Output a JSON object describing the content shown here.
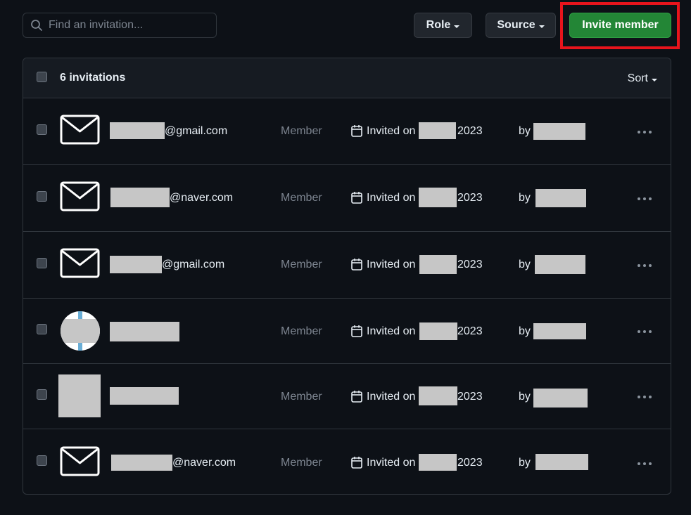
{
  "search": {
    "placeholder": "Find an invitation..."
  },
  "filters": {
    "role_label": "Role",
    "source_label": "Source"
  },
  "invite_button_label": "Invite member",
  "list": {
    "count_label": "6 invitations",
    "sort_label": "Sort"
  },
  "rows": [
    {
      "avatar": "mail-icon",
      "email_suffix": "@gmail.com",
      "role": "Member",
      "invited_label": "Invited on",
      "year": "2023",
      "by_label": "by"
    },
    {
      "avatar": "mail-icon",
      "email_suffix": "@naver.com",
      "role": "Member",
      "invited_label": "Invited on",
      "year": "2023",
      "by_label": "by"
    },
    {
      "avatar": "mail-icon",
      "email_suffix": "@gmail.com",
      "role": "Member",
      "invited_label": "Invited on",
      "year": "2023",
      "by_label": "by"
    },
    {
      "avatar": "user-avatar",
      "email_suffix": "",
      "role": "Member",
      "invited_label": "Invited on",
      "year": "2023",
      "by_label": "by"
    },
    {
      "avatar": "user-avatar",
      "email_suffix": "",
      "role": "Member",
      "invited_label": "Invited on",
      "year": "2023",
      "by_label": "by"
    },
    {
      "avatar": "mail-icon",
      "email_suffix": "@naver.com",
      "role": "Member",
      "invited_label": "Invited on",
      "year": "2023",
      "by_label": "by"
    }
  ],
  "colors": {
    "background": "#0d1117",
    "header": "#161b22",
    "border": "#30363d",
    "primary_button": "#238636",
    "highlight": "#e8141c",
    "redaction": "#c6c6c6"
  }
}
